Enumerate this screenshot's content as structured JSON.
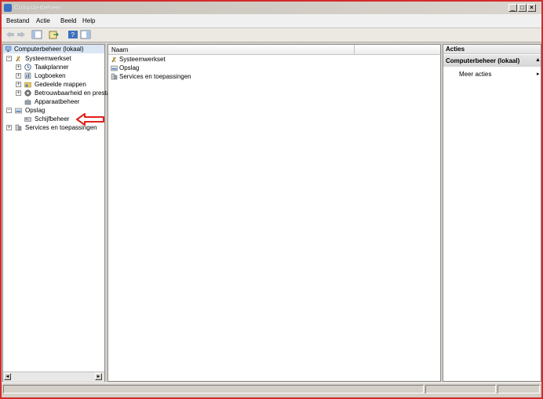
{
  "window": {
    "title": "Computerbeheer"
  },
  "menu": [
    "Bestand",
    "Actie",
    "Beeld",
    "Help"
  ],
  "tree": {
    "root": "Computerbeheer (lokaal)",
    "systeemwerkset": "Systeemwerkset",
    "taakplanner": "Taakplanner",
    "logboeken": "Logboeken",
    "gedeelde_mappen": "Gedeelde mappen",
    "betrouwbaarheid": "Betrouwbaarheid en presta",
    "apparaatbeheer": "Apparaatbeheer",
    "opslag": "Opslag",
    "schijfbeheer": "Schijfbeheer",
    "services": "Services en toepassingen"
  },
  "list": {
    "columns": [
      "Naam"
    ],
    "items": [
      "Systeemwerkset",
      "Opslag",
      "Services en toepassingen"
    ]
  },
  "actions": {
    "header": "Acties",
    "section": "Computerbeheer (lokaal)",
    "more": "Meer acties"
  },
  "colors": {
    "frame": "#d42a2a",
    "highlight_arrow": "#e0201c",
    "selection": "#dbe7f5"
  }
}
